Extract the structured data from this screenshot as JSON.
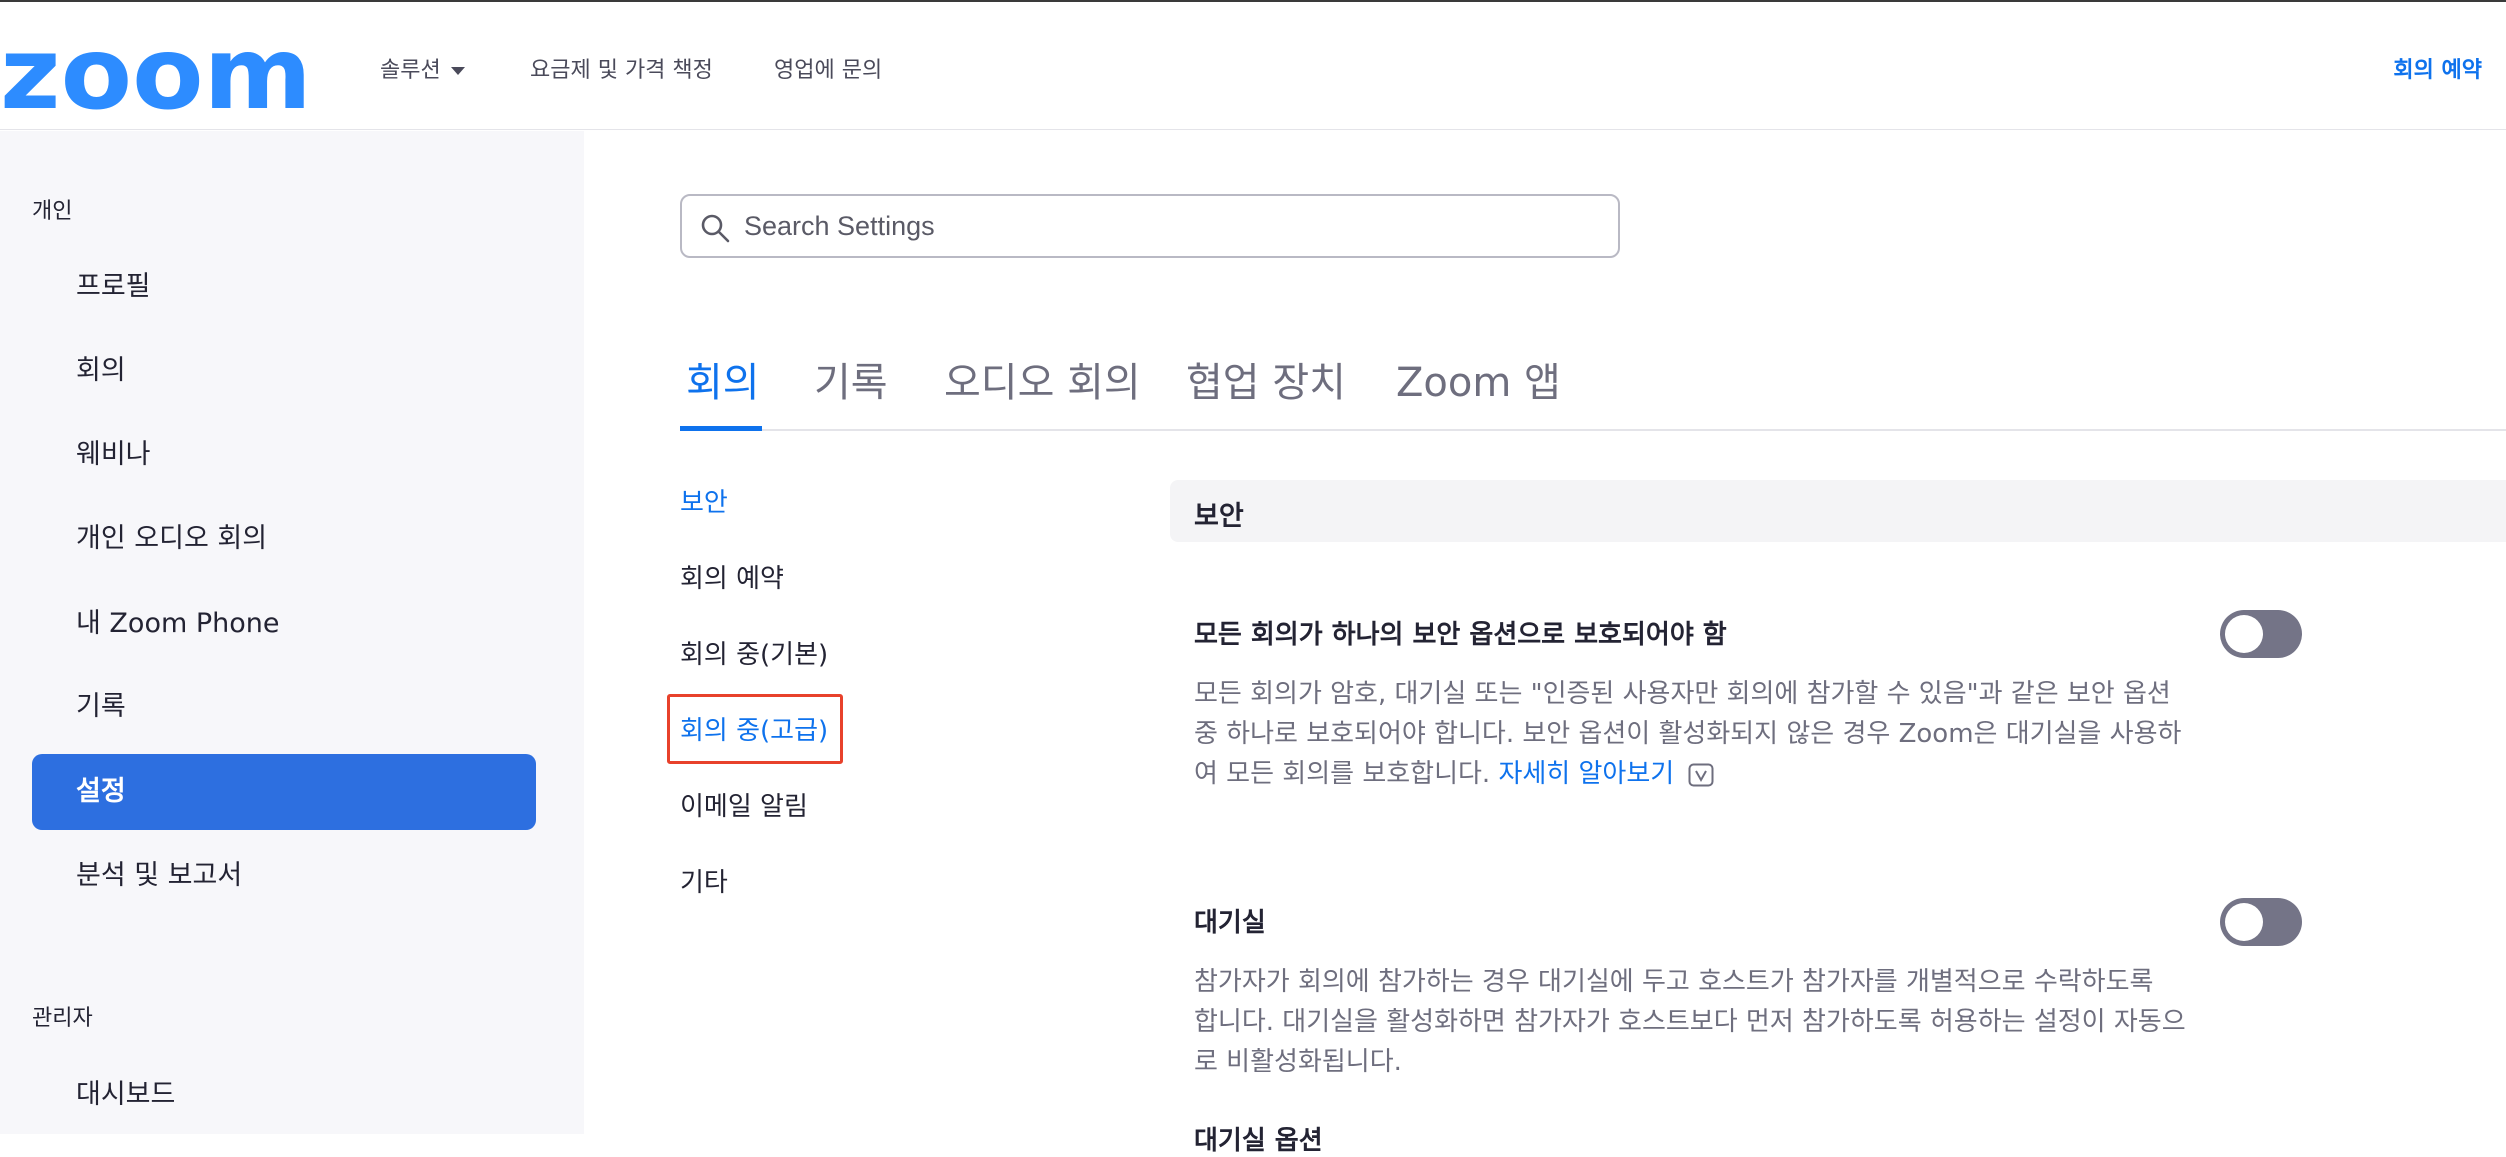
{
  "brand": {
    "logo_text": "zoom",
    "logo_color": "#2d8cff"
  },
  "header": {
    "nav": [
      {
        "label": "솔루션",
        "has_dropdown": true
      },
      {
        "label": "요금제 및 가격 책정"
      },
      {
        "label": "영업에 문의"
      }
    ],
    "schedule_label": "회의 예약"
  },
  "sidebar": {
    "personal_section": "개인",
    "items": [
      {
        "label": "프로필"
      },
      {
        "label": "회의"
      },
      {
        "label": "웨비나"
      },
      {
        "label": "개인 오디오 회의"
      },
      {
        "label": "내 Zoom Phone"
      },
      {
        "label": "기록"
      },
      {
        "label": "설정",
        "active": true
      },
      {
        "label": "분석 및 보고서"
      }
    ],
    "admin_section": "관리자",
    "admin_items": [
      {
        "label": "대시보드"
      }
    ]
  },
  "search": {
    "placeholder": "Search Settings",
    "value": ""
  },
  "tabs": [
    {
      "label": "회의",
      "active": true
    },
    {
      "label": "기록"
    },
    {
      "label": "오디오 회의"
    },
    {
      "label": "협업 장치"
    },
    {
      "label": "Zoom 앱"
    }
  ],
  "subnav": [
    {
      "label": "보안",
      "active": true
    },
    {
      "label": "회의 예약"
    },
    {
      "label": "회의 중(기본)"
    },
    {
      "label": "회의 중(고급)",
      "highlighted": true
    },
    {
      "label": "이메일 알림"
    },
    {
      "label": "기타"
    }
  ],
  "section": {
    "title": "보안",
    "settings": [
      {
        "title": "모든 회의가 하나의 보안 옵션으로 보호되어야 함",
        "desc_lines": [
          "모든 회의가 암호, 대기실 또는 \"인증된 사용자만 회의에 참가할 수 있음\"과 같은 보안 옵션",
          "중 하나로 보호되어야 합니다. 보안 옵션이 활성화되지 않은 경우 Zoom은 대기실을 사용하",
          "여 모든 회의를 보호합니다."
        ],
        "learn_more": "자세히 알아보기",
        "enabled": false
      },
      {
        "title": "대기실",
        "desc_lines": [
          "참가자가 회의에 참가하는 경우 대기실에 두고 호스트가 참가자를 개별적으로 수락하도록",
          "합니다. 대기실을 활성화하면 참가자가 호스트보다 먼저 참가하도록 허용하는 설정이 자동으",
          "로 비활성화됩니다."
        ],
        "enabled": false
      }
    ],
    "next_title": "대기실 옵션"
  }
}
